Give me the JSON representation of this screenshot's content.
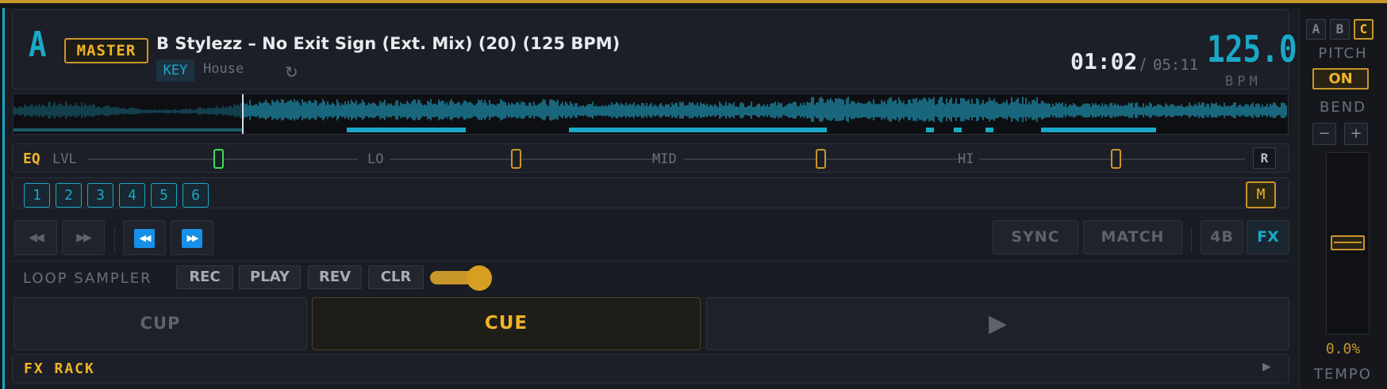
{
  "deck": {
    "letter": "A",
    "master_label": "MASTER",
    "track_title": "B Stylezz – No Exit Sign (Ext. Mix) (20) (125 BPM)",
    "key_label": "KEY",
    "genre": "House",
    "refresh_icon": "refresh-icon",
    "time_elapsed": "01:02",
    "time_separator": "/",
    "time_total": "05:11",
    "bpm": "125.0",
    "bpm_label": "BPM"
  },
  "eq": {
    "label": "EQ",
    "lvl": "LVL",
    "bands": [
      "LO",
      "MID",
      "HI"
    ],
    "reset": "R",
    "knob_colors": {
      "lvl": "#3ddc5a",
      "bands": "#c9962a"
    }
  },
  "hotcues": {
    "numbers": [
      "1",
      "2",
      "3",
      "4",
      "5",
      "6"
    ],
    "mode": "M"
  },
  "transport": {
    "prev_icon": "skip-previous-icon",
    "next_icon": "skip-next-icon",
    "rewind_icon": "rewind-icon",
    "fast_forward_icon": "fast-forward-icon",
    "sync": "SYNC",
    "match": "MATCH",
    "beats": "4B",
    "fx": "FX"
  },
  "loop_sampler": {
    "label": "LOOP SAMPLER",
    "rec": "REC",
    "play": "PLAY",
    "rev": "REV",
    "clr": "CLR",
    "level": 1.0
  },
  "buttons": {
    "cup": "CUP",
    "cue": "CUE",
    "play_icon": "play-icon"
  },
  "fx_rack": {
    "label": "FX RACK",
    "expand_icon": "play-small-icon"
  },
  "right_panel": {
    "deck_selectors": [
      "A",
      "B",
      "C"
    ],
    "active_deck": "C",
    "pitch_label": "PITCH",
    "pitch_state": "ON",
    "bend_label": "BEND",
    "bend_minus": "−",
    "bend_plus": "+",
    "tempo_value": "0.0%",
    "tempo_label": "TEMPO",
    "tempo_fader_position": 0.5
  },
  "colors": {
    "accent_cyan": "#1aa8c8",
    "accent_gold": "#f0b428",
    "background": "#1a1c23"
  }
}
